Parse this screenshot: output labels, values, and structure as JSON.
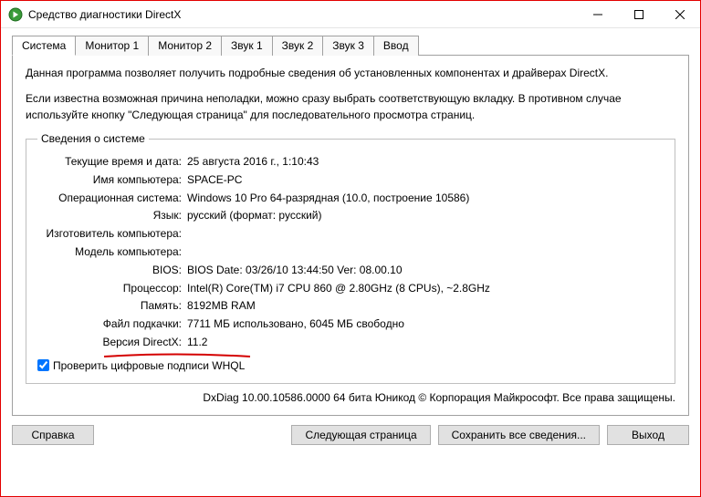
{
  "window": {
    "title": "Средство диагностики DirectX"
  },
  "tabs": [
    "Система",
    "Монитор 1",
    "Монитор 2",
    "Звук 1",
    "Звук 2",
    "Звук 3",
    "Ввод"
  ],
  "intro": {
    "p1": "Данная программа позволяет получить подробные сведения об установленных компонентах и драйверах DirectX.",
    "p2": "Если известна возможная причина неполадки, можно сразу выбрать соответствующую вкладку. В противном случае используйте кнопку \"Следующая страница\" для последовательного просмотра страниц."
  },
  "system": {
    "legend": "Сведения о системе",
    "rows": {
      "datetime": {
        "label": "Текущие время и дата:",
        "value": "25 августа 2016 г., 1:10:43"
      },
      "computername": {
        "label": "Имя компьютера:",
        "value": "SPACE-PC"
      },
      "os": {
        "label": "Операционная система:",
        "value": "Windows 10 Pro 64-разрядная (10.0, построение 10586)"
      },
      "language": {
        "label": "Язык:",
        "value": "русский (формат: русский)"
      },
      "manufacturer": {
        "label": "Изготовитель компьютера:",
        "value": ""
      },
      "model": {
        "label": "Модель компьютера:",
        "value": ""
      },
      "bios": {
        "label": "BIOS:",
        "value": "BIOS Date: 03/26/10 13:44:50 Ver: 08.00.10"
      },
      "cpu": {
        "label": "Процессор:",
        "value": "Intel(R) Core(TM) i7 CPU       860  @ 2.80GHz (8 CPUs), ~2.8GHz"
      },
      "memory": {
        "label": "Память:",
        "value": "8192MB RAM"
      },
      "pagefile": {
        "label": "Файл подкачки:",
        "value": "7711 МБ использовано, 6045 МБ свободно"
      },
      "directx": {
        "label": "Версия DirectX:",
        "value": "11.2"
      }
    }
  },
  "whql": {
    "label": "Проверить цифровые подписи WHQL",
    "checked": true
  },
  "footer": "DxDiag 10.00.10586.0000 64 бита Юникод © Корпорация Майкрософт. Все права защищены.",
  "buttons": {
    "help": "Справка",
    "next": "Следующая страница",
    "save": "Сохранить все сведения...",
    "exit": "Выход"
  }
}
